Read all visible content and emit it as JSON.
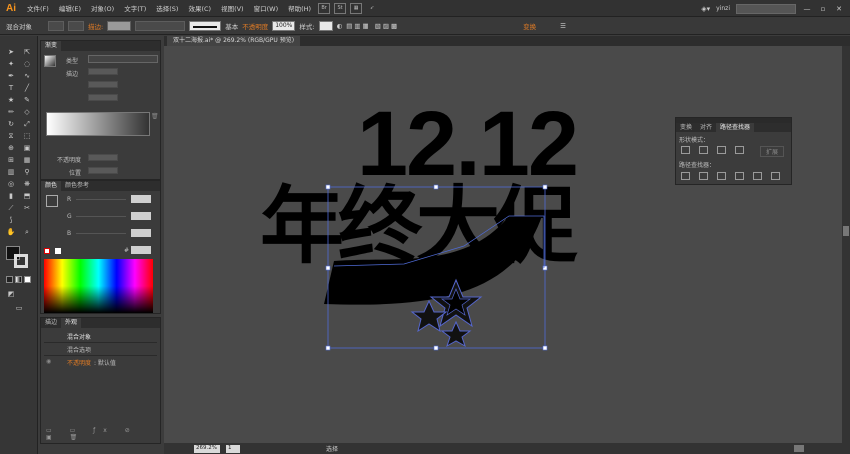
{
  "app": {
    "logo": "Ai"
  },
  "menu": [
    "文件(F)",
    "编辑(E)",
    "对象(O)",
    "文字(T)",
    "选择(S)",
    "效果(C)",
    "视图(V)",
    "窗口(W)",
    "帮助(H)"
  ],
  "menu_right": {
    "user": "yinzi",
    "minimize": "—",
    "restore": "▫",
    "close": "✕"
  },
  "control": {
    "selection": "混合对象",
    "stroke_label": "描边:",
    "stroke_style": "基本",
    "opacity_label": "不透明度",
    "opacity_value": "100%",
    "style_label": "样式:",
    "transform_label": "变换"
  },
  "gradient_panel": {
    "tab": "渐变",
    "type_label": "类型",
    "stroke_label": "描边",
    "opacity_label": "不透明度",
    "position_label": "位置"
  },
  "color_panel": {
    "tabs": [
      "颜色",
      "颜色参考"
    ],
    "r": "R",
    "g": "G",
    "b": "B",
    "hash": "#"
  },
  "appearance_panel": {
    "tabs": [
      "描边",
      "外观"
    ],
    "row1": "混合对象",
    "row2": "混合选项",
    "row3_label": "不透明度",
    "row3_value": ": 默认值"
  },
  "document": {
    "tab": "双十二海报.ai* @ 269.2% (RGB/GPU 预览)",
    "zoom": "269.2%",
    "page": "1",
    "status": "选择"
  },
  "artwork": {
    "line1": "12.12",
    "line2": "年终大促"
  },
  "pathfinder": {
    "tabs": [
      "变换",
      "对齐",
      "路径查找器"
    ],
    "shape_modes": "形状模式：",
    "expand": "扩展",
    "pathfinders": "路径查找器："
  },
  "colors": {
    "selection": "#4f6bd6",
    "accent": "#e07b25"
  }
}
